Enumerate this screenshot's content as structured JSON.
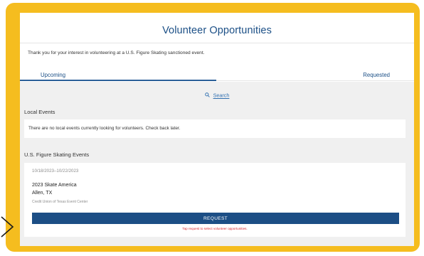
{
  "page": {
    "title": "Volunteer Opportunities",
    "intro": "Thank you for your interest in volunteering at a U.S. Figure Skating sanctioned event."
  },
  "tabs": [
    {
      "label": "Upcoming",
      "active": true
    },
    {
      "label": "Requested",
      "active": false
    }
  ],
  "search": {
    "label": "Search",
    "icon": "search-icon"
  },
  "local_events": {
    "heading": "Local Events",
    "message": "There are no local events currently looking for volunteers. Check back later."
  },
  "usfs_events": {
    "heading": "U.S. Figure Skating Events",
    "items": [
      {
        "dates": "10/18/2023–10/22/2023",
        "name": "2023 Skate America",
        "city": "Allen, TX",
        "venue": "Credit Union of Texas Event Center",
        "button_label": "REQUEST",
        "note": "Tap request to select volunteer opportunities."
      }
    ]
  },
  "colors": {
    "frame": "#f5bd1f",
    "brand_blue": "#1c4e85",
    "link_blue": "#2f6fb0",
    "note_red": "#d8262f",
    "panel_bg": "#f0f0f0"
  }
}
